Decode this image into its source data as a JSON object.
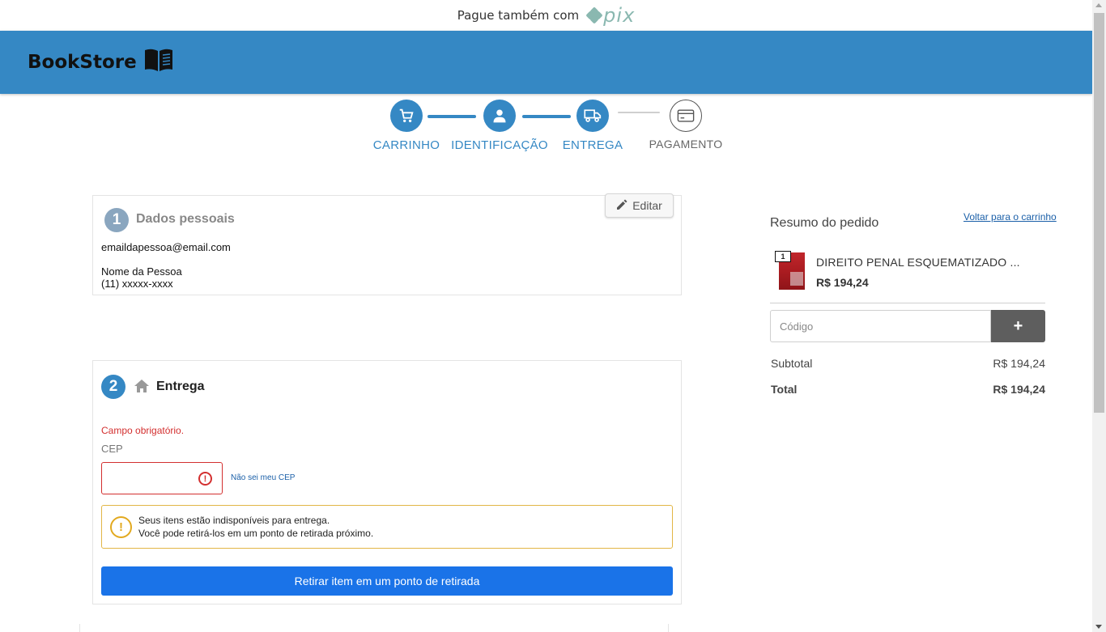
{
  "promo": {
    "text": "Pague também com",
    "pix_logo": "pix"
  },
  "header": {
    "brand": "BookStore",
    "brand_icon": "open-book-icon",
    "color": "#3588c4"
  },
  "stepper": {
    "steps": [
      {
        "label": "CARRINHO",
        "icon": "cart-icon",
        "state": "done"
      },
      {
        "label": "IDENTIFICAÇÃO",
        "icon": "user-icon",
        "state": "done"
      },
      {
        "label": "ENTREGA",
        "icon": "truck-icon",
        "state": "current"
      },
      {
        "label": "PAGAMENTO",
        "icon": "credit-card-icon",
        "state": "pending"
      }
    ]
  },
  "personal": {
    "number": "1",
    "title": "Dados pessoais",
    "edit_label": "Editar",
    "email": "emaildapessoa@email.com",
    "name": "Nome da Pessoa",
    "phone": "(11) xxxxx-xxxx"
  },
  "delivery": {
    "number": "2",
    "title": "Entrega",
    "error": "Campo obrigatório.",
    "cep_label": "CEP",
    "cep_value": "",
    "cep_help_link": "Não sei meu CEP",
    "warning_line1": "Seus itens estão indisponíveis para entrega.",
    "warning_line2": "Você pode retirá-los em um ponto de retirada próximo.",
    "pickup_button": "Retirar item em um ponto de retirada"
  },
  "summary": {
    "title": "Resumo do pedido",
    "back_link": "Voltar para o carrinho",
    "item": {
      "quantity": "1",
      "name": "DIREITO PENAL ESQUEMATIZADO ...",
      "price": "R$ 194,24"
    },
    "code_placeholder": "Código",
    "code_add_label": "+",
    "subtotal_label": "Subtotal",
    "subtotal_value": "R$ 194,24",
    "total_label": "Total",
    "total_value": "R$ 194,24"
  },
  "colors": {
    "accent": "#3588c4",
    "button_blue": "#1a73e8",
    "error": "#d32f2f",
    "warning": "#e2a91f"
  }
}
